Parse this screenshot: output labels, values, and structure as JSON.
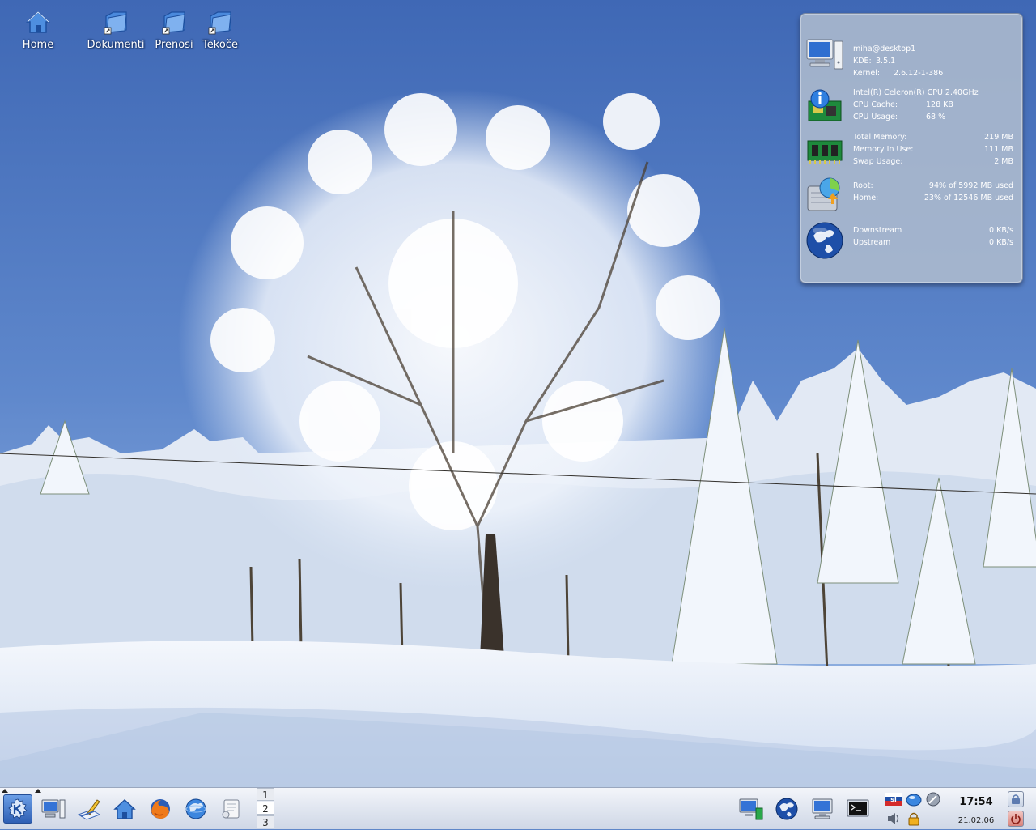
{
  "desktop": {
    "icons": [
      {
        "label": "Home",
        "icon": "home-icon"
      },
      {
        "label": "Dokumenti",
        "icon": "folder-link-icon"
      },
      {
        "label": "Prenosi",
        "icon": "folder-link-icon"
      },
      {
        "label": "Tekoče",
        "icon": "folder-link-icon"
      }
    ],
    "wallpaper": "snow-covered-tree-winter-landscape"
  },
  "sysinfo": {
    "system": {
      "user_host": "miha@desktop1",
      "kde_label": "KDE:",
      "kde_value": "3.5.1",
      "kernel_label": "Kernel:",
      "kernel_value": "2.6.12-1-386"
    },
    "cpu": {
      "model": "Intel(R) Celeron(R) CPU 2.40GHz",
      "cache_label": "CPU Cache:",
      "cache_value": "128 KB",
      "usage_label": "CPU Usage:",
      "usage_value": "68 %"
    },
    "memory": {
      "total_label": "Total Memory:",
      "total_value": "219 MB",
      "inuse_label": "Memory In Use:",
      "inuse_value": "111 MB",
      "swap_label": "Swap Usage:",
      "swap_value": "2 MB"
    },
    "disk": {
      "root_label": "Root:",
      "root_value": "94% of 5992 MB used",
      "home_label": "Home:",
      "home_value": "23% of 12546 MB used"
    },
    "network": {
      "down_label": "Downstream",
      "down_value": "0 KB/s",
      "up_label": "Upstream",
      "up_value": "0 KB/s"
    }
  },
  "panel": {
    "launchers": [
      "kmenu-icon",
      "system-icon",
      "writer-icon",
      "home-icon",
      "firefox-icon",
      "konqueror-icon",
      "note-icon"
    ],
    "pager": [
      "1",
      "2",
      "3"
    ],
    "active_desktop": "2",
    "tray": [
      "network-monitor-icon",
      "globe-icon",
      "computer-icon",
      "terminal-icon",
      "keyboard-layout-icon",
      "kopete-icon",
      "klipper-icon",
      "volume-icon",
      "lock-tray-icon"
    ],
    "keyboard_layout": "si",
    "clock_time": "17:54",
    "clock_date": "21.02.06",
    "colors": {
      "panel": "#dde3ee",
      "accent": "#2e5fb4",
      "logout": "#c0392b"
    }
  }
}
